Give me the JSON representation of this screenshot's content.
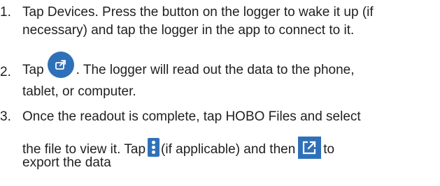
{
  "steps": [
    {
      "number": "1.",
      "line1": "Tap Devices. Press the button on the logger to wake it up (if",
      "line2": "necessary) and tap the logger in the app to connect to it."
    },
    {
      "number": "2.",
      "line1_before_icon": "Tap",
      "line1_after_icon": ". The logger will read out the data to the phone,",
      "line2": "tablet, or computer."
    },
    {
      "number": "3.",
      "line1": "Once the readout is complete, tap HOBO Files and select",
      "line2_part1": "the file to view it. Tap",
      "line2_part2": "(if applicable) and then",
      "line2_part3": "to",
      "line3": "export the data"
    }
  ],
  "icons": {
    "readout": "readout-icon",
    "more_options": "more-options-icon",
    "export": "export-icon",
    "accent_color": "#2f71b8"
  }
}
